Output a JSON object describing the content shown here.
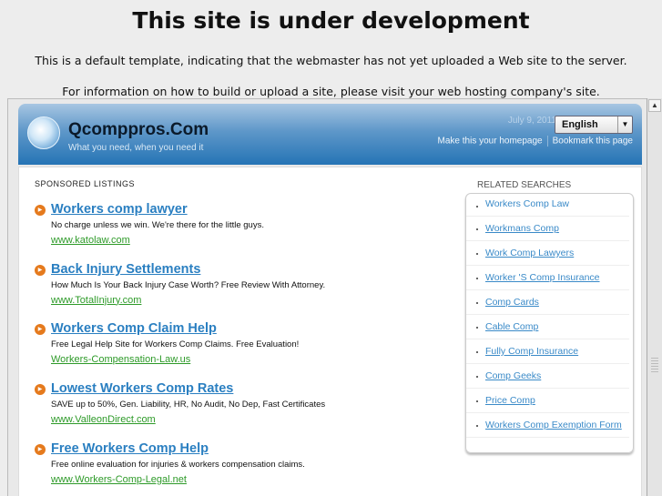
{
  "notice": {
    "title": "This site is under development",
    "line1": "This is a default template, indicating that the webmaster has not yet uploaded a Web site to the server.",
    "line2": "For information on how to build or upload a site, please visit your web hosting company's site."
  },
  "header": {
    "logo": "Qcomppros.Com",
    "tagline": "What you need, when you need it",
    "date": "July 9, 2011",
    "language": "English",
    "homepage_link": "Make this your homepage",
    "bookmark_link": "Bookmark this page"
  },
  "sponsored": {
    "title": "SPONSORED LISTINGS",
    "items": [
      {
        "title": "Workers comp lawyer",
        "desc": "No charge unless we win. We're there for the little guys.",
        "url": "www.katolaw.com"
      },
      {
        "title": "Back Injury Settlements",
        "desc": "How Much Is Your Back Injury Case Worth? Free Review With Attorney.",
        "url": "www.TotalInjury.com"
      },
      {
        "title": "Workers Comp Claim Help",
        "desc": "Free Legal Help Site for Workers Comp Claims. Free Evaluation!",
        "url": "Workers-Compensation-Law.us"
      },
      {
        "title": "Lowest Workers Comp Rates",
        "desc": "SAVE up to 50%, Gen. Liability, HR, No Audit, No Dep, Fast Certificates",
        "url": "www.ValleonDirect.com"
      },
      {
        "title": "Free Workers Comp Help",
        "desc": "Free online evaluation for injuries & workers compensation claims.",
        "url": "www.Workers-Comp-Legal.net"
      }
    ]
  },
  "related": {
    "title": "RELATED SEARCHES",
    "items": [
      "Workers Comp Law",
      "Workmans Comp",
      "Work Comp Lawyers",
      "Worker 'S Comp Insurance",
      "Comp Cards",
      "Cable Comp",
      "Fully Comp Insurance",
      "Comp Geeks",
      "Price Comp",
      "Workers Comp Exemption Form"
    ]
  }
}
